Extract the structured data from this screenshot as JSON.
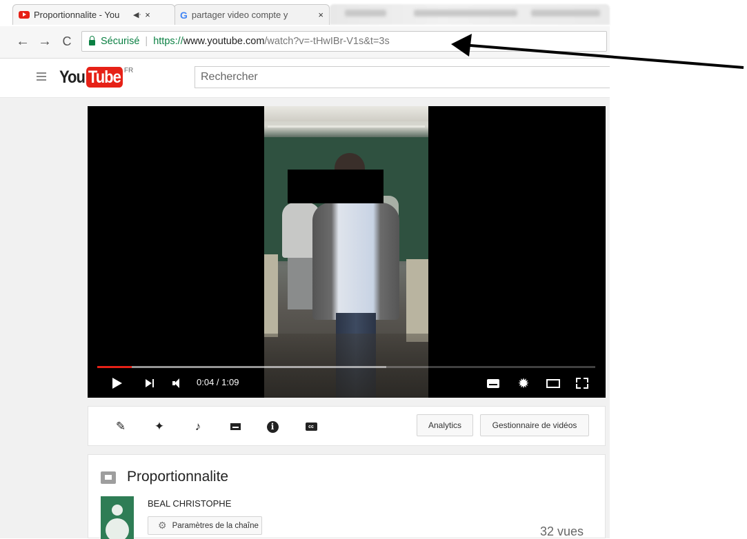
{
  "browser": {
    "tabs": [
      {
        "title": "Proportionnalite - You",
        "close": "×"
      },
      {
        "title": "partager video compte y",
        "close": "×"
      }
    ],
    "nav": {
      "back": "←",
      "forward": "→",
      "reload": "C"
    },
    "address": {
      "secure_label": "Sécurisé",
      "separator": "|",
      "scheme": "https://",
      "host": "www.youtube.com",
      "path": "/watch?v=-tHwIBr-V1s&t=3s"
    }
  },
  "youtube": {
    "menu_icon": "hamburger-icon",
    "logo": {
      "you": "You",
      "tube": "Tube",
      "region": "FR"
    },
    "search": {
      "placeholder": "Rechercher"
    }
  },
  "player": {
    "time": "0:04 / 1:09",
    "progress": {
      "played_fraction": 0.069,
      "buffered_fraction": 0.58
    }
  },
  "edit_toolbar": {
    "icons": [
      "pencil-icon",
      "magic-wand-icon",
      "music-note-icon",
      "annotations-icon",
      "info-icon",
      "cc-icon"
    ],
    "analytics_label": "Analytics",
    "video_manager_label": "Gestionnaire de vidéos"
  },
  "video_info": {
    "title": "Proportionnalite",
    "channel": "BEAL CHRISTOPHE",
    "channel_settings_label": "Paramètres de la chaîne",
    "views": "32 vues"
  },
  "colors": {
    "youtube_red": "#e62117",
    "secure_green": "#0b8043",
    "avatar_green": "#2e7d55"
  }
}
